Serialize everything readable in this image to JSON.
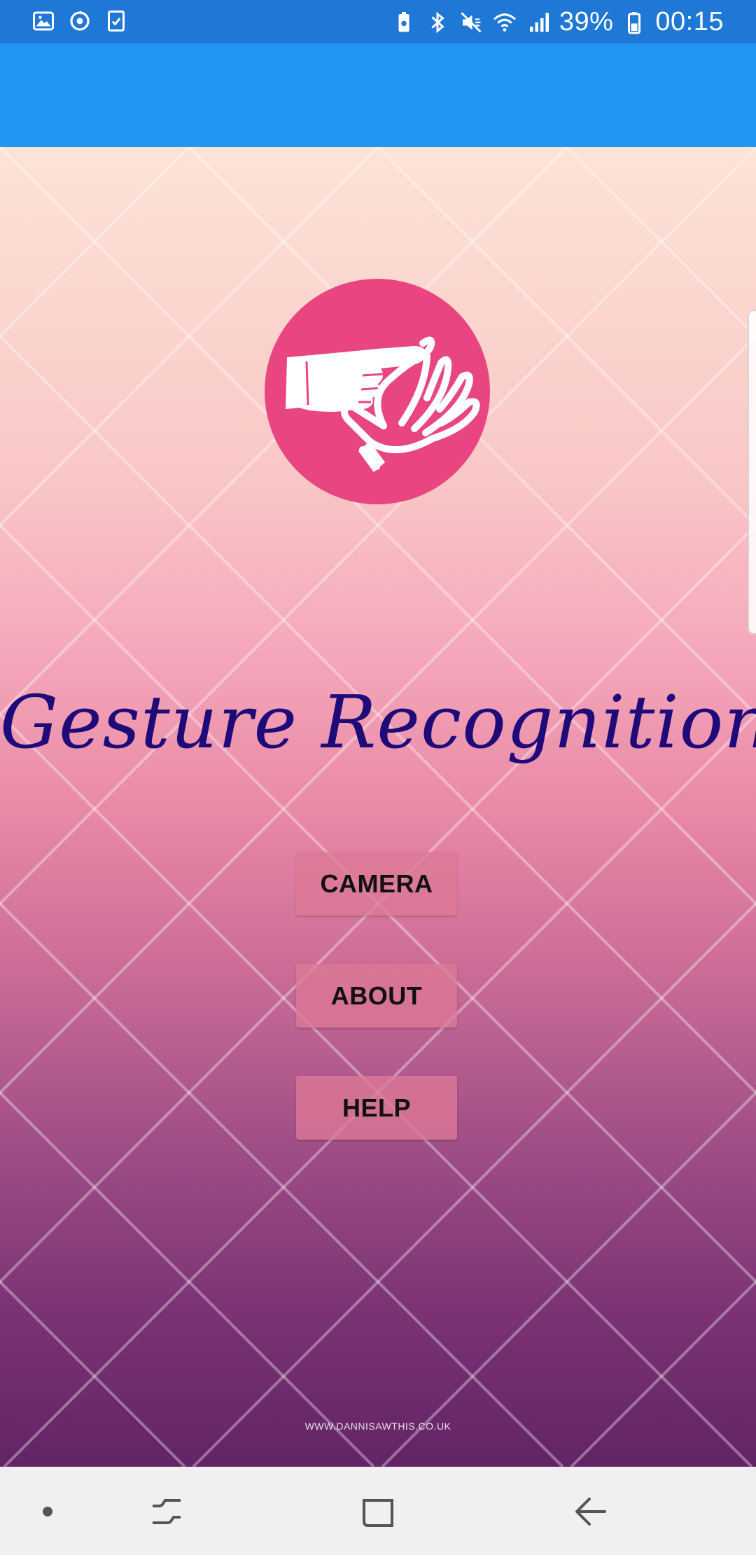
{
  "status_bar": {
    "battery_percent": "39%",
    "time": "00:15",
    "icons_left": [
      "gallery-icon",
      "sync-icon",
      "task-icon"
    ],
    "icons_right": [
      "battery-saver-icon",
      "bluetooth-icon",
      "mute-icon",
      "wifi-icon",
      "signal-icon",
      "battery-icon"
    ]
  },
  "app": {
    "title": "Gesture Recognition",
    "logo_icon": "hand-gesture-icon",
    "accent_color": "#2196f3",
    "status_bar_color": "#1f78d6",
    "logo_color": "#e84581",
    "title_color": "#1f0a7a"
  },
  "buttons": {
    "camera": "CAMERA",
    "about": "ABOUT",
    "help": "HELP"
  },
  "watermark": "WWW.DANNISAWTHIS.CO.UK",
  "nav": {
    "icons": [
      "dot-icon",
      "recent-apps-icon",
      "home-icon",
      "back-icon"
    ]
  }
}
